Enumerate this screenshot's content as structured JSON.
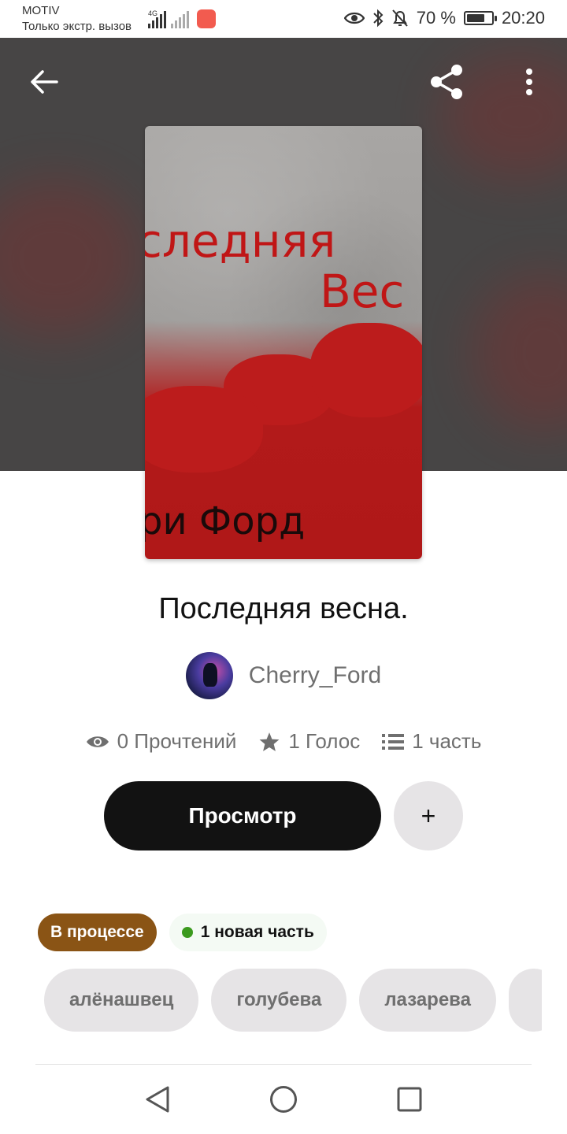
{
  "status_bar": {
    "carrier": "MOTIV",
    "carrier_status": "Только экстр. вызов",
    "network_type": "4G",
    "battery_percent": "70 %",
    "time": "20:20"
  },
  "header": {
    "back_icon": "arrow-left-icon",
    "share_icon": "share-icon",
    "menu_icon": "more-vertical-icon"
  },
  "cover": {
    "line1": "следняя",
    "line2": "Вес",
    "line3": "ри Форд"
  },
  "story": {
    "title": "Последняя весна.",
    "author": "Cherry_Ford"
  },
  "stats": {
    "reads": "0 Прочтений",
    "votes": "1 Голос",
    "parts": "1 часть"
  },
  "actions": {
    "read_label": "Просмотр",
    "add_label": "+"
  },
  "badges": {
    "status": "В процессе",
    "new_parts": "1 новая часть"
  },
  "tags": [
    "алёнашвец",
    "голубева",
    "лазарева",
    ""
  ],
  "colors": {
    "status_badge": "#8a5415",
    "new_dot": "#3b9a1e",
    "primary_button": "#121212"
  }
}
